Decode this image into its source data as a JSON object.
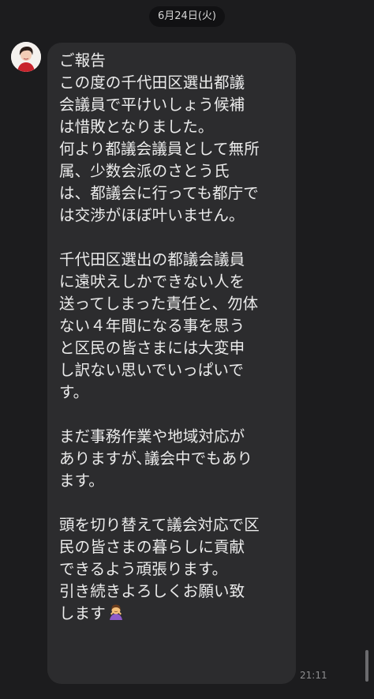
{
  "chat": {
    "date_separator": "6月24日(火)",
    "sender_avatar_icon": "profile-photo-icon",
    "message": {
      "paragraphs": [
        [
          "ご報告",
          "この度の千代田区選出都議",
          "会議員で平けいしょう候補",
          "は惜敗となりました。",
          "何より都議会議員として無所",
          "属、少数会派のさとう氏",
          "は、都議会に行っても都庁で",
          "は交渉がほぼ叶いません。"
        ],
        [
          "千代田区選出の都議会議員",
          "に遠吠えしかできない人を",
          "送ってしまった責任と、勿体",
          "ない４年間になる事を思う",
          "と区民の皆さまには大変申",
          "し訳ない思いでいっぱいで",
          "す。"
        ],
        [
          "まだ事務作業や地域対応が",
          "ありますが､議会中でもあり",
          "ます。"
        ],
        [
          "頭を切り替えて議会対応で区",
          "民の皆さまの暮らしに貢献",
          "できるよう頑張ります。",
          "引き続きよろしくお願い致",
          "します"
        ]
      ],
      "trailing_emoji": "person-bowing-icon",
      "time": "21:11"
    }
  },
  "colors": {
    "background": "#1c1c1e",
    "bubble": "#2c2c2e",
    "text": "#ececec",
    "time_text": "#8d8d8f"
  }
}
